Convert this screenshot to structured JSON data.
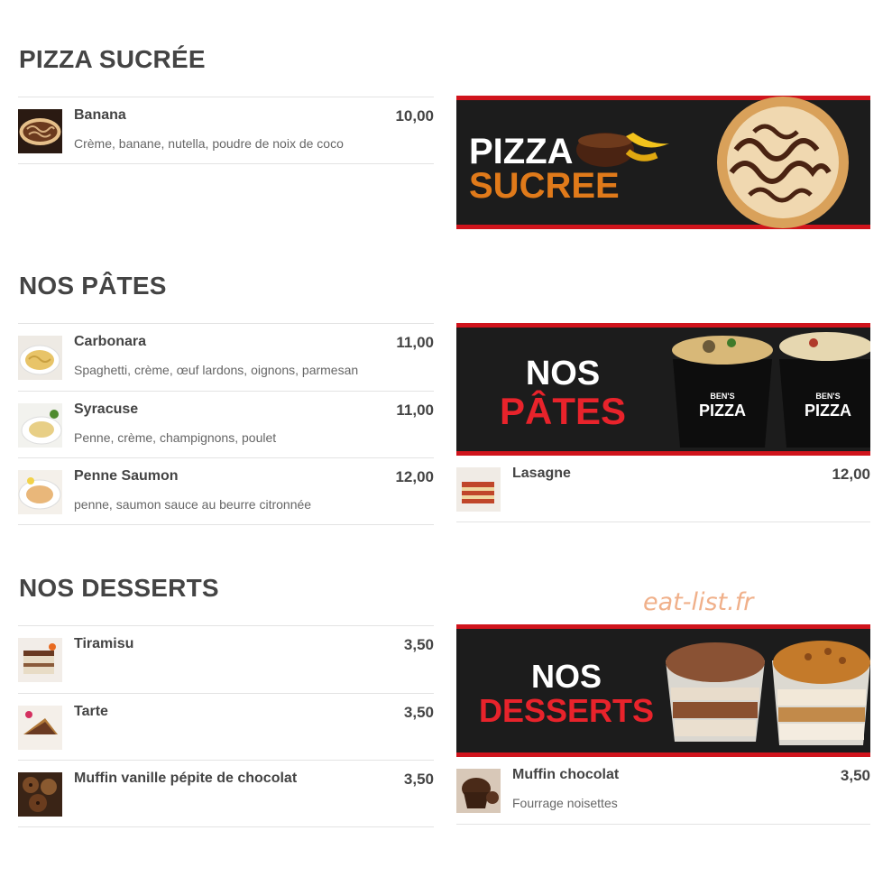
{
  "sections": {
    "sucree": {
      "title": "PIZZA SUCRÉE",
      "items": [
        {
          "name": "Banana",
          "desc": "Crème, banane, nutella, poudre de noix de coco",
          "price": "10,00"
        }
      ],
      "banner": {
        "line1": "PIZZA",
        "line2": "SUCREE"
      }
    },
    "pates": {
      "title": "NOS PÂTES",
      "items": [
        {
          "name": "Carbonara",
          "desc": "Spaghetti, crème, œuf lardons, oignons, parmesan",
          "price": "11,00"
        },
        {
          "name": "Syracuse",
          "desc": "Penne, crème, champignons, poulet",
          "price": "11,00"
        },
        {
          "name": "Penne Saumon",
          "desc": "penne, saumon sauce au beurre citronnée",
          "price": "12,00"
        }
      ],
      "right_items": [
        {
          "name": "Lasagne",
          "desc": "",
          "price": "12,00"
        }
      ],
      "banner": {
        "line1": "NOS",
        "line2": "PÂTES",
        "cup_brand": "BEN'S",
        "cup_label": "PIZZA"
      }
    },
    "desserts": {
      "title": "NOS DESSERTS",
      "items": [
        {
          "name": "Tiramisu",
          "desc": "",
          "price": "3,50"
        },
        {
          "name": "Tarte",
          "desc": "",
          "price": "3,50"
        },
        {
          "name": "Muffin vanille pépite de chocolat",
          "desc": "",
          "price": "3,50"
        }
      ],
      "right_items": [
        {
          "name": "Muffin chocolat",
          "desc": "Fourrage noisettes",
          "price": "3,50"
        }
      ],
      "banner": {
        "line1": "NOS",
        "line2": "DESSERTS"
      }
    }
  },
  "watermark": "eat-list.fr",
  "colors": {
    "banner_bg": "#1c1c1c",
    "banner_accent": "#d0141c",
    "orange_text": "#e07a1a",
    "text": "#444444"
  }
}
